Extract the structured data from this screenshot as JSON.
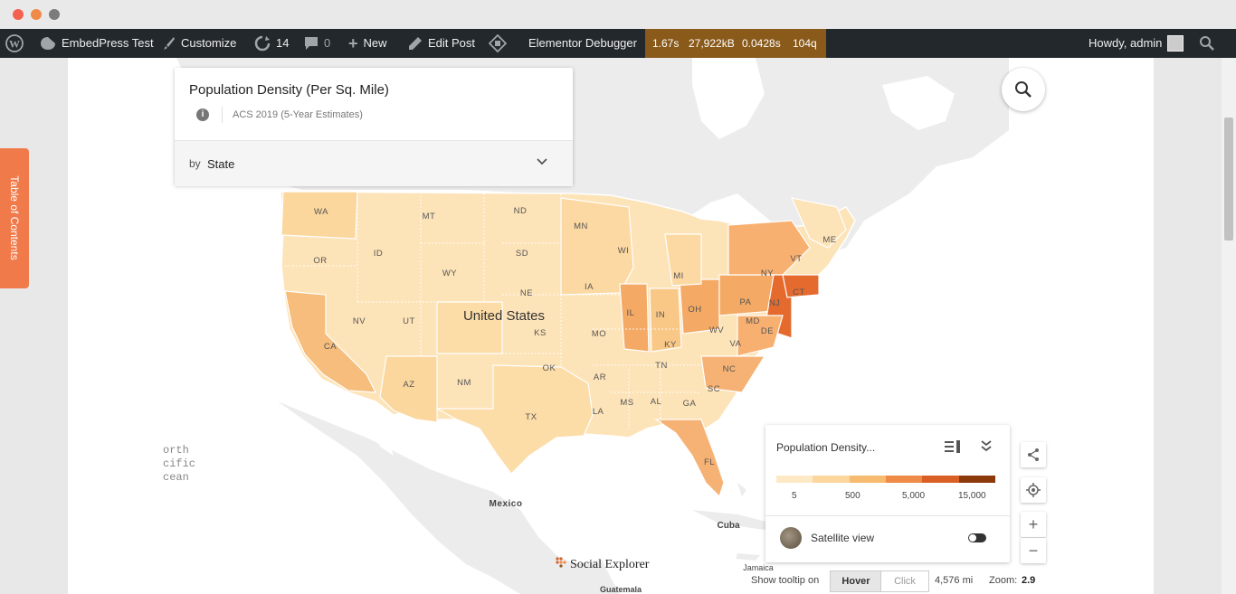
{
  "admin_bar": {
    "site_name": "EmbedPress Test",
    "customize": "Customize",
    "updates_count": "14",
    "comments_count": "0",
    "new_label": "New",
    "edit_post": "Edit Post",
    "debugger": "Elementor Debugger",
    "stats": [
      "1.67s",
      "27,922kB",
      "0.0428s",
      "104q"
    ],
    "howdy": "Howdy, admin"
  },
  "toc_label": "Table of Contents",
  "map_panel": {
    "title": "Population Density (Per Sq. Mile)",
    "source": "ACS 2019 (5-Year Estimates)",
    "by_label": "by",
    "by_value": "State"
  },
  "map_labels": {
    "country": "United States",
    "mexico": "Mexico",
    "cuba": "Cuba",
    "jamaica": "Jamaica",
    "guatemala": "Guatemala",
    "ocean_lines": [
      "orth",
      "cific",
      "cean"
    ],
    "brand": "Social Explorer",
    "states": [
      "WA",
      "MT",
      "ND",
      "MN",
      "OR",
      "ID",
      "SD",
      "WI",
      "WY",
      "NE",
      "IA",
      "IL",
      "IN",
      "OH",
      "PA",
      "NY",
      "VT",
      "ME",
      "MI",
      "NV",
      "UT",
      "CA",
      "KS",
      "MO",
      "KY",
      "WV",
      "VA",
      "MD",
      "DE",
      "NJ",
      "CT",
      "AZ",
      "NM",
      "OK",
      "AR",
      "TN",
      "NC",
      "SC",
      "GA",
      "AL",
      "MS",
      "LA",
      "TX",
      "FL"
    ]
  },
  "legend": {
    "title": "Population Density...",
    "ticks": [
      "5",
      "500",
      "5,000",
      "15,000"
    ],
    "colors": [
      "#fde9c6",
      "#fbd79e",
      "#f7bb6f",
      "#ef8a47",
      "#d95f24",
      "#8c3a0c"
    ],
    "satellite_label": "Satellite view",
    "satellite_on": false
  },
  "bottom_bar": {
    "tooltip_label": "Show tooltip on",
    "hover": "Hover",
    "click": "Click",
    "scale": "4,576 mi",
    "zoom_label": "Zoom:",
    "zoom_value": "2.9"
  },
  "icons": [
    "wordpress-icon",
    "home-icon",
    "brush-icon",
    "refresh-icon",
    "comment-icon",
    "plus-icon",
    "pencil-icon",
    "elementor-icon",
    "search-icon",
    "info-icon",
    "chevron-down-icon",
    "legend-list-icon",
    "collapse-icon",
    "share-icon",
    "locate-icon",
    "zoom-in-icon",
    "zoom-out-icon"
  ]
}
